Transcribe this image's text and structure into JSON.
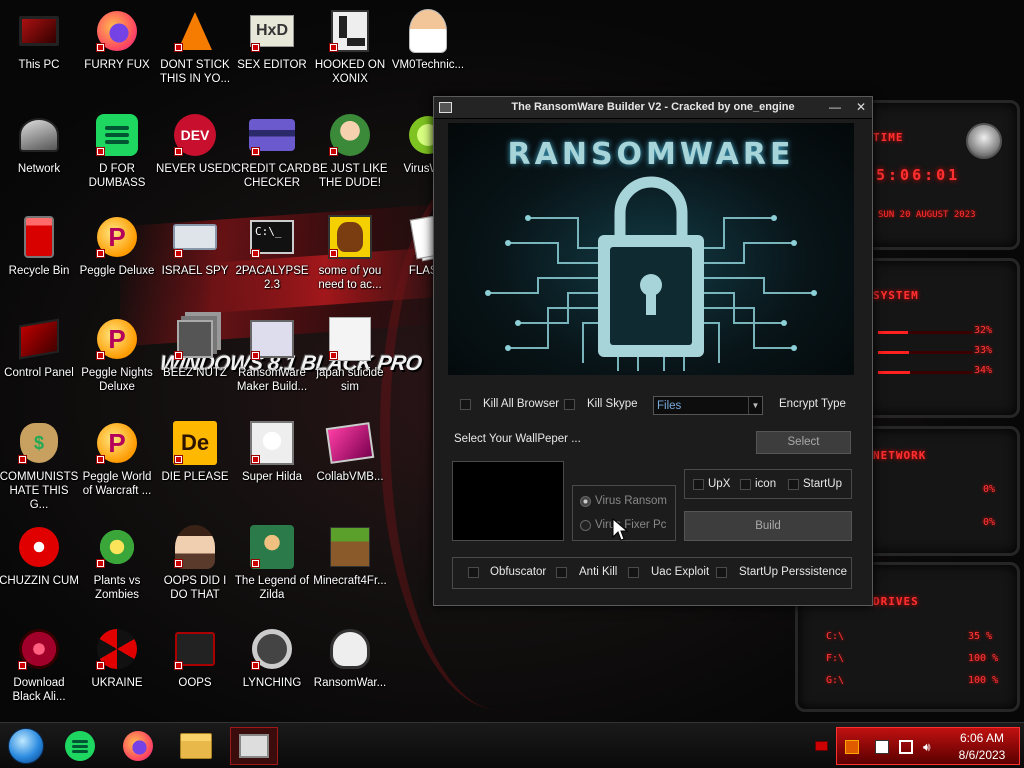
{
  "desktop": {
    "brand_text": "WINDOWS 8.1 BLACK PRO",
    "icons": [
      {
        "label": "This PC"
      },
      {
        "label": "FURRY FUX"
      },
      {
        "label": "DONT STICK THIS IN YO..."
      },
      {
        "label": "SEX EDITOR"
      },
      {
        "label": "HOOKED ON XONIX"
      },
      {
        "label": "VM0Technic..."
      },
      {
        "label": "Network"
      },
      {
        "label": "D FOR DUMBASS"
      },
      {
        "label": "NEVER USED!"
      },
      {
        "label": "CREDIT CARD CHECKER"
      },
      {
        "label": "BE JUST LIKE THE DUDE!"
      },
      {
        "label": "VirusWi..."
      },
      {
        "label": "Recycle Bin"
      },
      {
        "label": "Peggle Deluxe"
      },
      {
        "label": "ISRAEL SPY"
      },
      {
        "label": "2PACALYPSE 2.3"
      },
      {
        "label": "some of you need to ac..."
      },
      {
        "label": "FLAS..."
      },
      {
        "label": "Control Panel"
      },
      {
        "label": "Peggle Nights Deluxe"
      },
      {
        "label": "BEEZ NUTZ"
      },
      {
        "label": "Ransomware Maker Build..."
      },
      {
        "label": "japan suicide sim"
      },
      {
        "label": "COMMUNISTS HATE THIS G..."
      },
      {
        "label": "Peggle World of Warcraft ..."
      },
      {
        "label": "DIE PLEASE"
      },
      {
        "label": "Super Hilda"
      },
      {
        "label": "CollabVMB..."
      },
      {
        "label": "CHUZZIN CUM"
      },
      {
        "label": "Plants vs Zombies"
      },
      {
        "label": "OOPS DID I DO THAT"
      },
      {
        "label": "The Legend of Zilda"
      },
      {
        "label": "Minecraft4Fr..."
      },
      {
        "label": "Download Black Ali..."
      },
      {
        "label": "UKRAINE"
      },
      {
        "label": "OOPS"
      },
      {
        "label": "LYNCHING"
      },
      {
        "label": "RansomWar..."
      }
    ]
  },
  "gadget": {
    "time_title": "TIME",
    "clock": "5:06:01",
    "date": "SUN 20 AUGUST 2023",
    "system_title": "SYSTEM",
    "system_values": [
      "32%",
      "33%",
      "34%"
    ],
    "network_title": "NETWORK",
    "network_values": [
      "0%",
      "0%"
    ],
    "drives_title": "DRIVES",
    "drives": [
      {
        "name": "C:\\",
        "value": "35 %"
      },
      {
        "name": "F:\\",
        "value": "100 %"
      },
      {
        "name": "G:\\",
        "value": "100 %"
      }
    ]
  },
  "window": {
    "title": "The RansomWare Builder V2 - Cracked by one_engine",
    "minimize": "—",
    "close": "✕",
    "banner_title": "RANSOMWARE",
    "kill_all_browser": "Kill All Browser",
    "kill_skype": "Kill Skype",
    "encrypt_combo_value": "Files",
    "encrypt_type_label": "Encrypt Type",
    "wallpaper_label": "Select Your WallPeper ...",
    "select_button": "Select",
    "upx": "UpX",
    "icon": "icon",
    "startup": "StartUp",
    "build_button": "Build",
    "virus_ransom": "Virus Ransom",
    "virus_fixer": "Virus Fixer Pc",
    "obfuscator": "Obfuscator",
    "anti_kill": "Anti Kill",
    "uac_exploit": "Uac Exploit",
    "startup_persistence": "StartUp Perssistence"
  },
  "taskbar": {
    "items": [
      "start-orb",
      "spotify",
      "firefox",
      "file-explorer",
      "ransomware-builder"
    ],
    "time": "6:06 AM",
    "date": "8/6/2023"
  },
  "colors": {
    "accent_red": "#ff3030",
    "window_bg": "#1c1c1c",
    "banner_cyan": "#a7d4d8"
  }
}
